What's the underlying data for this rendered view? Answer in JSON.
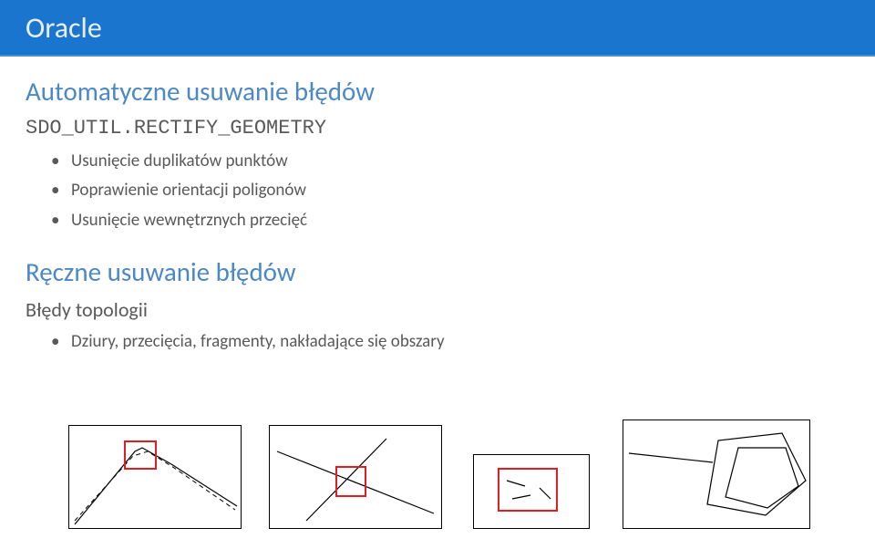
{
  "header": {
    "title": "Oracle"
  },
  "section1": {
    "heading": "Automatyczne usuwanie błędów",
    "code": "SDO_UTIL.RECTIFY_GEOMETRY",
    "bullets": [
      "Usunięcie duplikatów punktów",
      "Poprawienie orientacji poligonów",
      "Usunięcie wewnętrznych przecięć"
    ]
  },
  "section2": {
    "heading": "Ręczne usuwanie błędów",
    "sub": "Błędy topologii",
    "bullets": [
      "Dziury, przecięcia, fragmenty, nakładające się obszary"
    ]
  }
}
